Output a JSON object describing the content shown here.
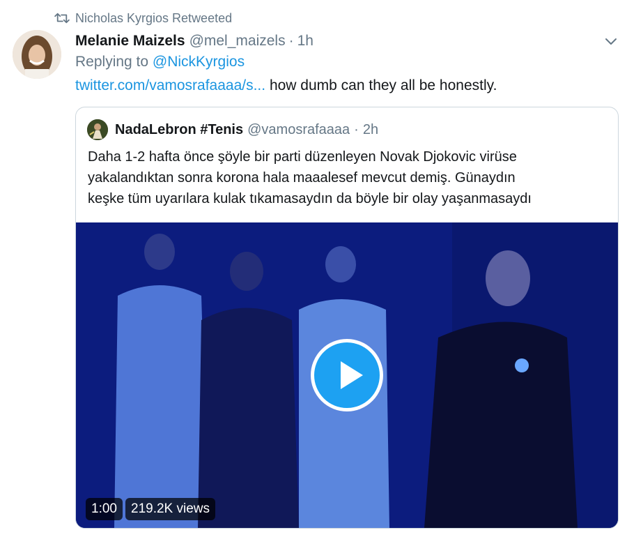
{
  "retweet": {
    "icon": "retweet-icon",
    "text": "Nicholas Kyrgios Retweeted"
  },
  "tweet": {
    "author_name": "Melanie Maizels",
    "author_handle": "@mel_maizels",
    "separator": "·",
    "time": "1h",
    "replying_prefix": "Replying to",
    "replying_handle": "@NickKyrgios",
    "link_text": "twitter.com/vamosrafaaaa/s...",
    "body_text": " how dumb can they all be honestly."
  },
  "quote": {
    "author_name": "NadaLebron #Tenis",
    "author_handle": "@vamosrafaaaa",
    "separator": "·",
    "time": "2h",
    "text": "Daha 1-2 hafta önce şöyle bir parti düzenleyen Novak Djokovic virüse\nyakalandıktan sonra korona hala maaalesef mevcut demiş. Günaydın\nkeşke tüm uyarılara kulak tıkamasaydın da böyle bir olay yaşanmasaydı",
    "video": {
      "duration": "1:00",
      "views": "219.2K views"
    }
  },
  "colors": {
    "link": "#1b95e0",
    "muted": "#657786",
    "play": "#1da1f2"
  }
}
